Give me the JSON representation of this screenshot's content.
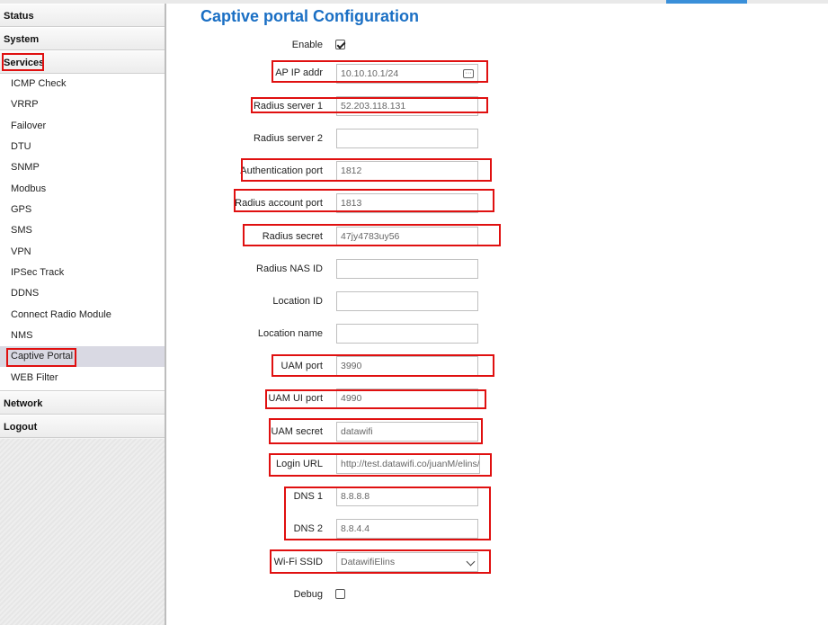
{
  "sidebar": {
    "sections": [
      "Status",
      "System",
      "Services",
      "Network",
      "Logout"
    ],
    "services_items": [
      "ICMP Check",
      "VRRP",
      "Failover",
      "DTU",
      "SNMP",
      "Modbus",
      "GPS",
      "SMS",
      "VPN",
      "IPSec Track",
      "DDNS",
      "Connect Radio Module",
      "NMS",
      "Captive Portal",
      "WEB Filter"
    ],
    "active_item": "Captive Portal"
  },
  "page": {
    "title": "Captive portal Configuration"
  },
  "form": {
    "enable": {
      "label": "Enable",
      "checked": true
    },
    "ap_ip": {
      "label": "AP IP addr",
      "value": "10.10.10.1/24"
    },
    "radius1": {
      "label": "Radius server 1",
      "value": "52.203.118.131"
    },
    "radius2": {
      "label": "Radius server 2",
      "value": ""
    },
    "auth_port": {
      "label": "Authentication port",
      "value": "1812"
    },
    "acct_port": {
      "label": "Radius account port",
      "value": "1813"
    },
    "secret": {
      "label": "Radius secret",
      "value": "47jy4783uy56"
    },
    "nas_id": {
      "label": "Radius NAS ID",
      "value": ""
    },
    "location_id": {
      "label": "Location ID",
      "value": ""
    },
    "location_name": {
      "label": "Location name",
      "value": ""
    },
    "uam_port": {
      "label": "UAM port",
      "value": "3990"
    },
    "uam_ui_port": {
      "label": "UAM UI port",
      "value": "4990"
    },
    "uam_secret": {
      "label": "UAM secret",
      "value": "datawifi"
    },
    "login_url": {
      "label": "Login URL",
      "value": "http://test.datawifi.co/juanM/elins/lo"
    },
    "dns1": {
      "label": "DNS 1",
      "value": "8.8.8.8"
    },
    "dns2": {
      "label": "DNS 2",
      "value": "8.8.4.4"
    },
    "ssid": {
      "label": "Wi-Fi SSID",
      "value": "DatawifiElins"
    },
    "debug": {
      "label": "Debug",
      "checked": false
    }
  },
  "colors": {
    "accent": "#1a6fc4",
    "highlight": "#e01010",
    "active_bg": "#d9d9e3"
  }
}
